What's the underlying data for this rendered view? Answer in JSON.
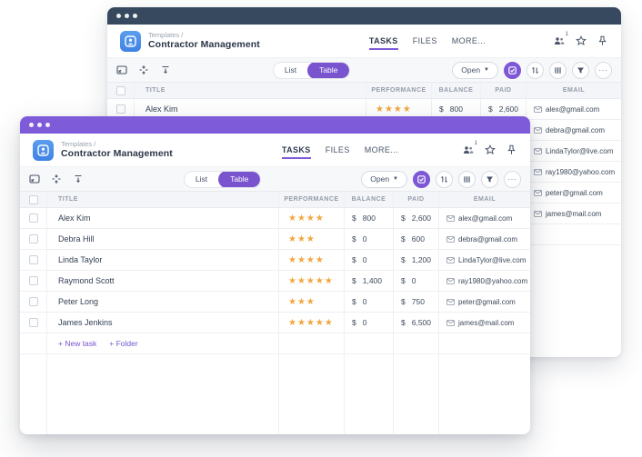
{
  "colors": {
    "front_titlebar_purple": "#7e5bd8",
    "back_titlebar_navy": "#36495e",
    "accent_purple": "#7a53cf",
    "star_orange": "#f2a73e",
    "app_icon_blue": "#4f93e8"
  },
  "window": {
    "breadcrumb": "Templates /",
    "title": "Contractor Management",
    "tabs": {
      "tasks": "TASKS",
      "files": "FILES",
      "more": "MORE..."
    },
    "share_count": "1",
    "toolbar": {
      "list": "List",
      "table": "Table",
      "open": "Open",
      "more": "..."
    },
    "table": {
      "currency": "$",
      "columns": {
        "title": "TITLE",
        "performance": "PERFORMANCE",
        "balance": "BALANCE",
        "paid": "PAID",
        "email": "EMAIL"
      },
      "rows": [
        {
          "title": "Alex Kim",
          "performance": 4,
          "balance": "800",
          "paid": "2,600",
          "email": "alex@gmail.com"
        },
        {
          "title": "Debra Hill",
          "performance": 3,
          "balance": "0",
          "paid": "600",
          "email": "debra@gmail.com"
        },
        {
          "title": "Linda Taylor",
          "performance": 4,
          "balance": "0",
          "paid": "1,200",
          "email": "LindaTylor@live.com"
        },
        {
          "title": "Raymond Scott",
          "performance": 5,
          "balance": "1,400",
          "paid": "0",
          "email": "ray1980@yahoo.com"
        },
        {
          "title": "Peter Long",
          "performance": 3,
          "balance": "0",
          "paid": "750",
          "email": "peter@gmail.com"
        },
        {
          "title": "James Jenkins",
          "performance": 5,
          "balance": "0",
          "paid": "6,500",
          "email": "james@mail.com"
        }
      ]
    },
    "footer": {
      "new_task": "+ New task",
      "folder": "+ Folder"
    }
  }
}
